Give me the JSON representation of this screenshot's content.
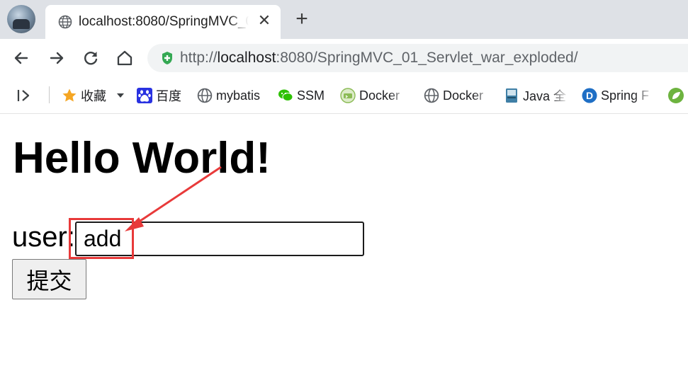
{
  "browser": {
    "tab": {
      "title": "localhost:8080/SpringMVC_01_Servlet_war_exploded/"
    },
    "address_bar": {
      "url_prefix": "http://",
      "url_host": "localhost",
      "url_rest": ":8080/SpringMVC_01_Servlet_war_exploded/"
    },
    "bookmarks": [
      {
        "label": "收藏",
        "icon": "star-icon"
      },
      {
        "label": "百度",
        "icon": "baidu-paw-icon"
      },
      {
        "label": "mybatis",
        "icon": "globe-icon"
      },
      {
        "label": "SSM",
        "icon": "wechat-icon"
      },
      {
        "label": "Docker",
        "icon": "docker-icon"
      },
      {
        "label": "Docker",
        "icon": "globe-icon"
      },
      {
        "label": "Java 全",
        "icon": "java-book-icon"
      },
      {
        "label": "Spring F",
        "icon": "spring-d-icon"
      },
      {
        "label": "",
        "icon": "spring-leaf-icon"
      }
    ]
  },
  "page": {
    "heading": "Hello World!",
    "form": {
      "user_label": "user:",
      "user_value": "add",
      "submit_label": "提交"
    }
  },
  "colors": {
    "annotation": "#e83a3a",
    "tab_strip": "#dee1e6",
    "omnibox": "#f1f3f4",
    "secure_badge": "#34a853"
  }
}
